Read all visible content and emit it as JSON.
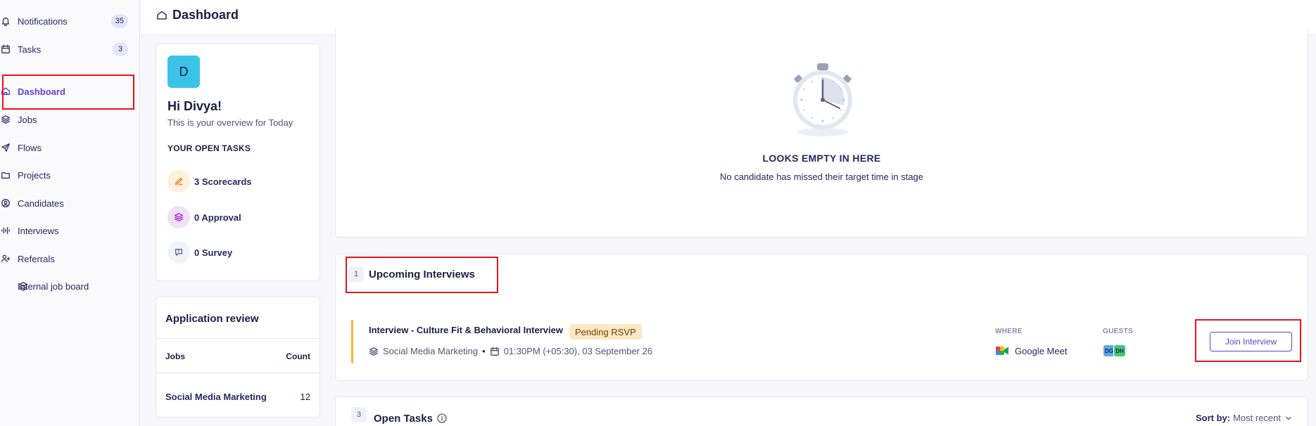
{
  "sidebar": {
    "items": [
      {
        "label": "Notifications",
        "badge": "35",
        "icon": "bell-icon"
      },
      {
        "label": "Tasks",
        "badge": "3",
        "icon": "calendar-check-icon"
      },
      {
        "label": "Dashboard",
        "icon": "home-icon",
        "active": true
      },
      {
        "label": "Jobs",
        "icon": "layers-icon"
      },
      {
        "label": "Flows",
        "icon": "send-icon"
      },
      {
        "label": "Projects",
        "icon": "folder-icon"
      },
      {
        "label": "Candidates",
        "icon": "user-circle-icon"
      },
      {
        "label": "Interviews",
        "icon": "audio-wave-icon"
      },
      {
        "label": "Referrals",
        "icon": "user-plus-icon"
      },
      {
        "label": "Internal job board",
        "icon": "stack-board-icon"
      }
    ]
  },
  "header": {
    "title": "Dashboard",
    "icon": "home-icon"
  },
  "welcome": {
    "avatar_initial": "D",
    "greeting": "Hi Divya!",
    "subtitle": "This is your overview for Today",
    "tasks_title": "YOUR OPEN TASKS",
    "tasks": [
      {
        "label": "3 Scorecards",
        "icon": "pen-icon"
      },
      {
        "label": "0 Approval",
        "icon": "layers-icon"
      },
      {
        "label": "0 Survey",
        "icon": "message-icon"
      }
    ]
  },
  "application_review": {
    "title": "Application review",
    "columns": [
      "Jobs",
      "Count"
    ],
    "rows": [
      {
        "job": "Social Media Marketing",
        "count": "12"
      }
    ]
  },
  "empty_state": {
    "title": "LOOKS EMPTY IN HERE",
    "subtitle": "No candidate has missed their target time in stage",
    "icon": "stopwatch-icon"
  },
  "upcoming": {
    "count": "1",
    "title": "Upcoming Interviews",
    "interview": {
      "title": "Interview - Culture Fit & Behavioral Interview",
      "status": "Pending RSVP",
      "job": "Social Media Marketing",
      "time": "01:30PM (+05:30), 03 September 26",
      "where_label": "WHERE",
      "where": "Google Meet",
      "guests_label": "GUESTS",
      "guests": [
        "DG",
        "DH"
      ],
      "join_label": "Join Interview"
    }
  },
  "open_tasks": {
    "count": "3",
    "title": "Open Tasks",
    "sort_label": "Sort by:",
    "sort_value": "Most recent"
  },
  "colors": {
    "accent": "#5a45cf",
    "highlight": "#e8131c",
    "avatar": "#3cc3e8",
    "pending_bg": "#fde8c5",
    "interview_bar": "#f5b82e"
  }
}
